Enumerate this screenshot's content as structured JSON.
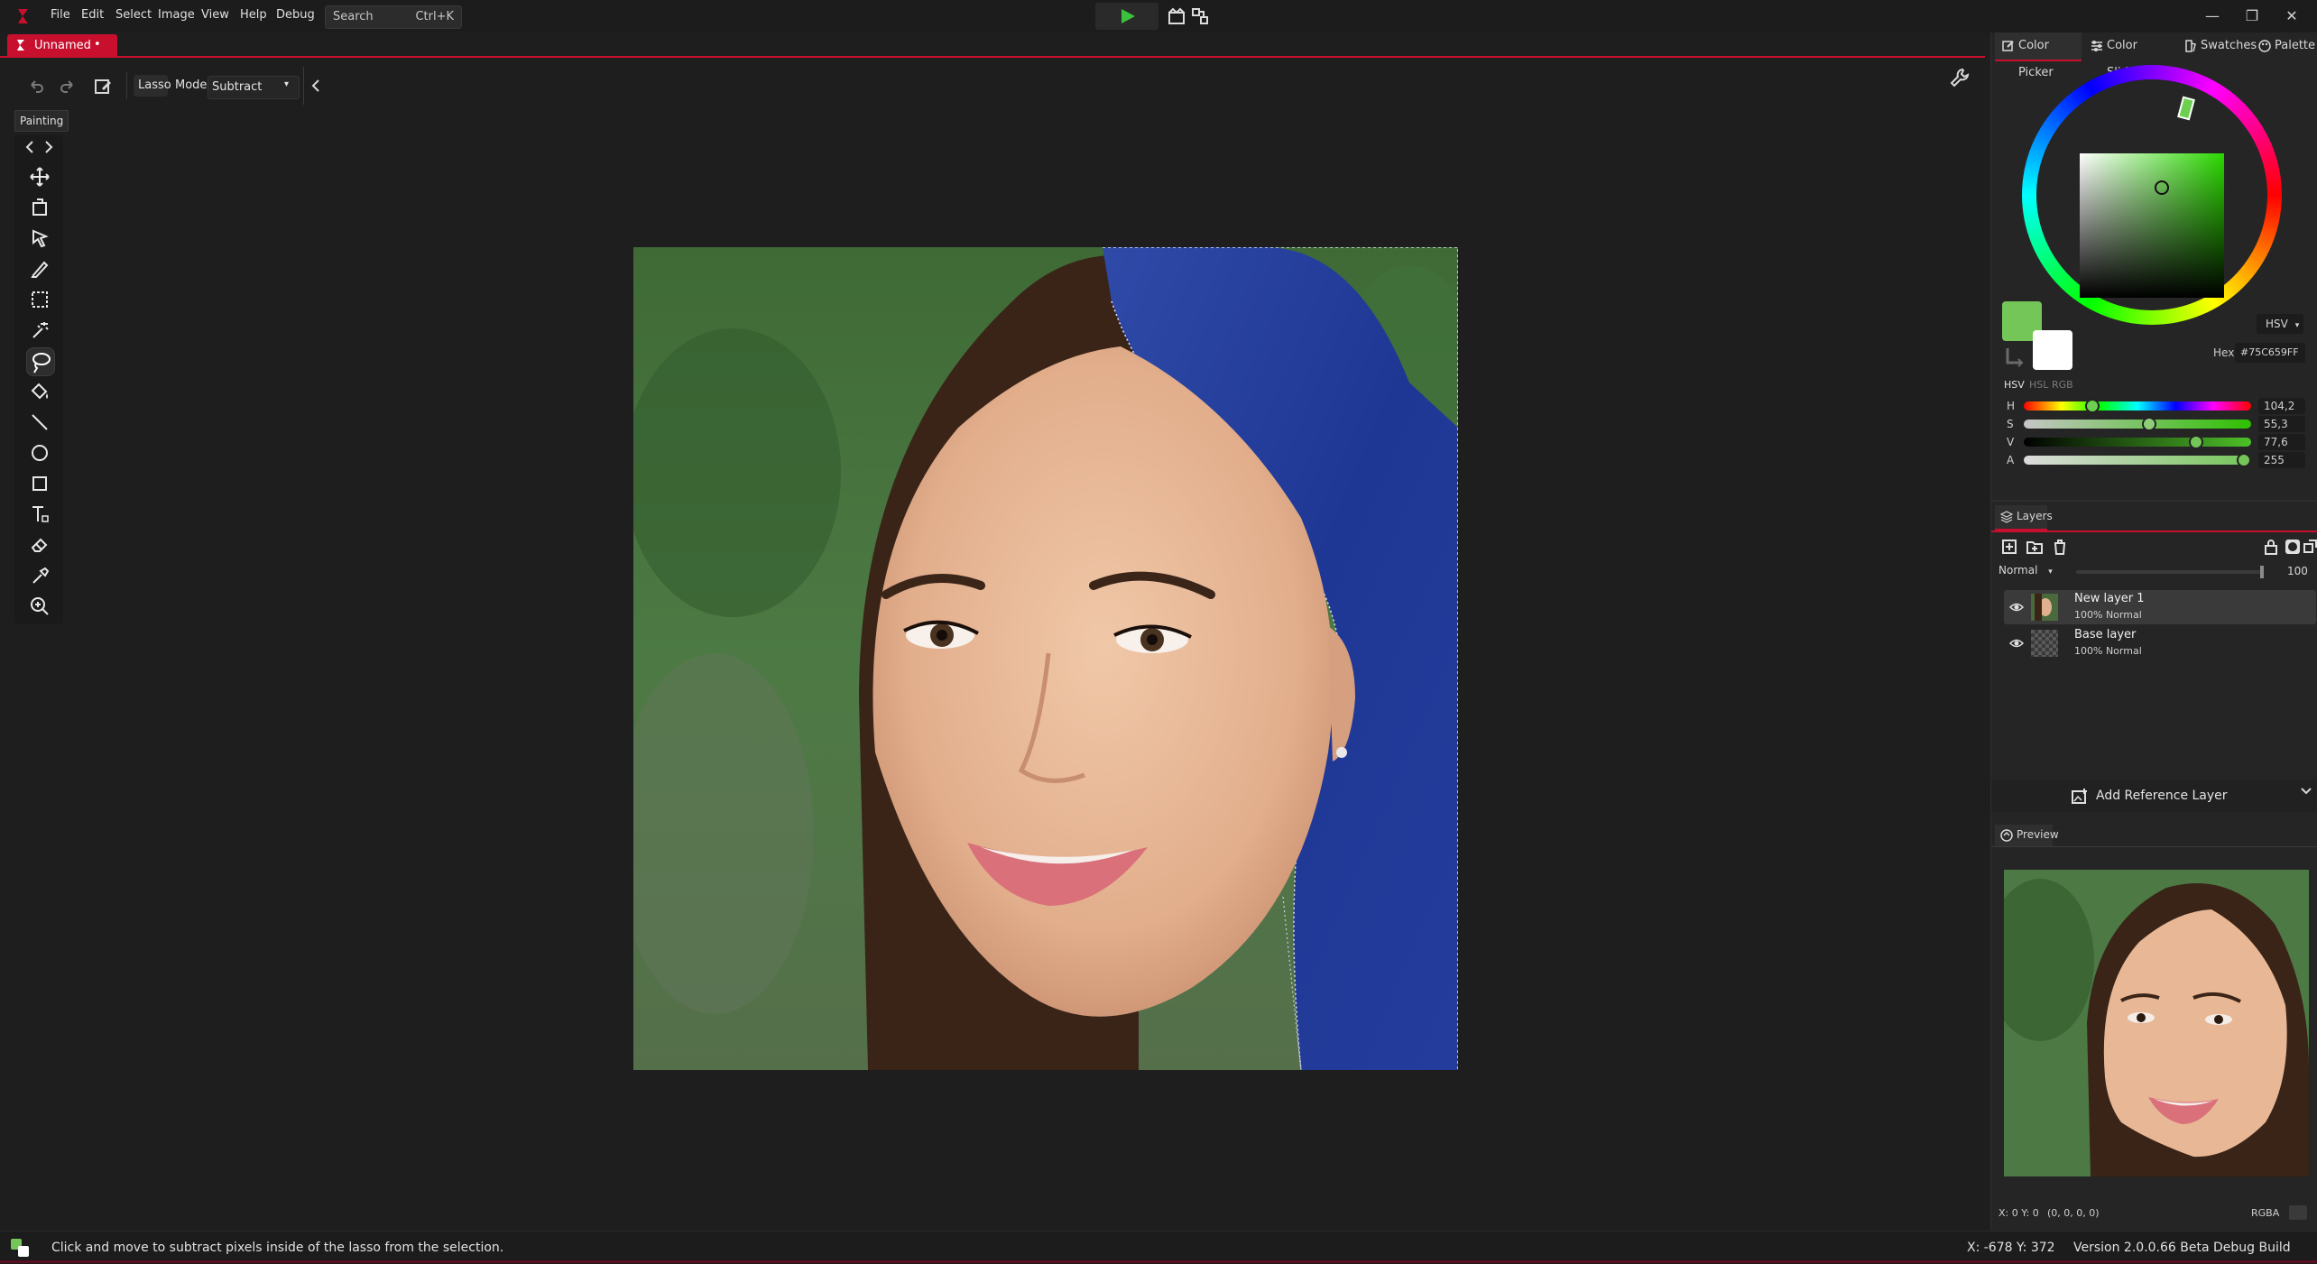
{
  "menu": {
    "items": [
      "File",
      "Edit",
      "Select",
      "Image",
      "View",
      "Help",
      "Debug"
    ],
    "search_label": "Search",
    "search_shortcut": "Ctrl+K"
  },
  "document": {
    "tab_label": "Unnamed",
    "unsaved_marker": "•"
  },
  "options": {
    "tool_label": "Lasso",
    "mode_label": "Mode",
    "mode_value": "Subtract"
  },
  "tools": {
    "tooltip": "Painting",
    "items": [
      "Move",
      "Transform",
      "Select",
      "Brush",
      "Rectangle select",
      "Magic wand",
      "Lasso",
      "Fill",
      "Line",
      "Ellipse",
      "Rectangle",
      "Text",
      "Eraser",
      "Color picker",
      "Zoom"
    ],
    "active": "Lasso"
  },
  "color_panel": {
    "tabs": [
      "Color Picker",
      "Color Sliders",
      "Swatches",
      "Palette"
    ],
    "active_tab": "Color Picker",
    "model_select": "HSV",
    "hex_label": "Hex",
    "hex_value": "#75C659FF",
    "modes": [
      "HSV",
      "HSL",
      "RGB"
    ],
    "primary_color": "#75C659",
    "secondary_color": "#FFFFFF",
    "sliders": [
      {
        "label": "H",
        "value": "104,2",
        "fraction": 0.29
      },
      {
        "label": "S",
        "value": "55,3",
        "fraction": 0.553
      },
      {
        "label": "V",
        "value": "77,6",
        "fraction": 0.776
      },
      {
        "label": "A",
        "value": "255",
        "fraction": 1.0
      }
    ]
  },
  "layers_panel": {
    "title": "Layers",
    "blend_mode": "Normal",
    "opacity": "100",
    "layers": [
      {
        "name": "New layer 1",
        "sub": "100% Normal",
        "selected": true
      },
      {
        "name": "Base layer",
        "sub": "100% Normal",
        "selected": false
      }
    ],
    "add_reference_label": "Add Reference Layer"
  },
  "preview_panel": {
    "title": "Preview",
    "coords": "X: 0 Y: 0",
    "rgba_values": "(0, 0, 0, 0)",
    "mode": "RGBA"
  },
  "status": {
    "message": "Click and move to subtract pixels inside of the lasso from the selection.",
    "cursor": "X: -678 Y: 372",
    "version": "Version 2.0.0.66 Beta Debug Build"
  },
  "colors": {
    "accent": "#C8102E",
    "selection_overlay": "#1E3A9E",
    "play_green": "#3CC23C"
  }
}
